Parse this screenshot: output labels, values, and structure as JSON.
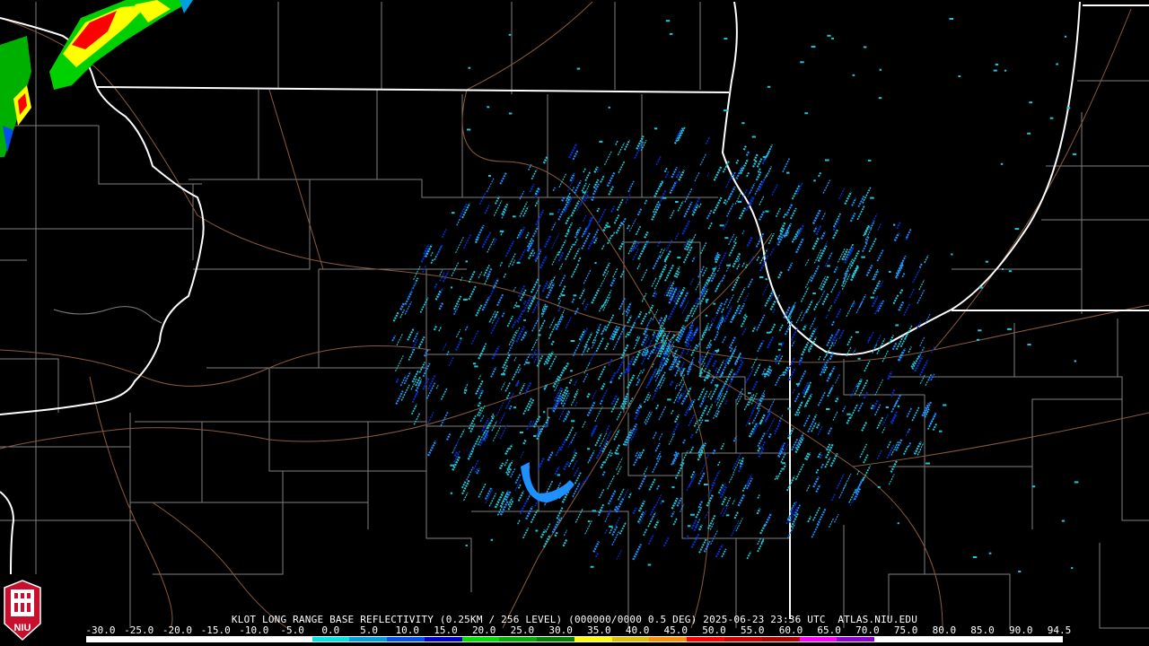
{
  "product": {
    "title": "KLOT LONG RANGE BASE REFLECTIVITY (0.25KM / 256 LEVEL) (000000/0000 0.5 DEG) 2025-06-23 23:36 UTC  ATLAS.NIU.EDU"
  },
  "logo": {
    "text": "NIU",
    "icon": "niu-tower-logo-icon"
  },
  "color_scale": {
    "labels": [
      "-30.0",
      "-25.0",
      "-20.0",
      "-15.0",
      "-10.0",
      "-5.0",
      "0.0",
      "5.0",
      "10.0",
      "15.0",
      "20.0",
      "25.0",
      "30.0",
      "35.0",
      "40.0",
      "45.0",
      "50.0",
      "55.0",
      "60.0",
      "65.0",
      "70.0",
      "75.0",
      "80.0",
      "85.0",
      "90.0",
      "94.5"
    ],
    "colors": [
      "#ffffff",
      "#ffffff",
      "#ffffff",
      "#ffffff",
      "#ffffff",
      "#ffffff",
      "#00e5e5",
      "#00a0e0",
      "#0050f0",
      "#0000c8",
      "#00e000",
      "#00b000",
      "#008000",
      "#ffff00",
      "#e0c000",
      "#ff9000",
      "#ff0000",
      "#d00000",
      "#b00000",
      "#ff00ff",
      "#9000d0",
      "#ffffff",
      "#ffffff",
      "#ffffff",
      "#ffffff",
      "#ffffff"
    ]
  },
  "map_colors": {
    "background": "#000000",
    "state_border": "#ffffff",
    "county_border": "#909090",
    "roads": "#8b5a3c",
    "echo_light": "#1ec8d8",
    "echo_medium": "#1e90ff",
    "echo_heavy": "#0030d0"
  }
}
